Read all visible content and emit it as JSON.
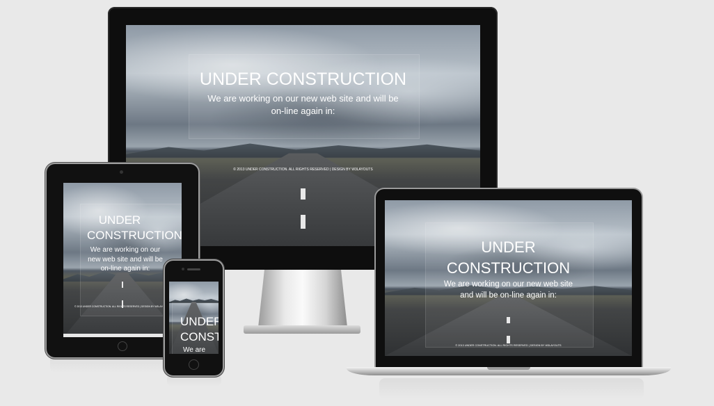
{
  "site": {
    "title": "UNDER CONSTRUCTION",
    "title_line1": "UNDER",
    "title_line2": "CONSTRUCTION",
    "title_phone_line1": "UNDER",
    "title_phone_line2": "CONSTRUCTI",
    "subtitle": "We are working on our new web site and will be on-line again in:",
    "subtitle_phone": "We are",
    "footer": "© 2013 UNDER CONSTRUCTION. ALL RIGHTS RESERVED | DESIGN BY W3LAYOUTS"
  },
  "colors": {
    "background": "#e9e9e9",
    "bezel": "#0d0d0d",
    "silver": "#c8c8c8",
    "text": "#ffffff"
  },
  "devices": [
    "desktop-monitor",
    "tablet",
    "laptop",
    "smartphone"
  ]
}
